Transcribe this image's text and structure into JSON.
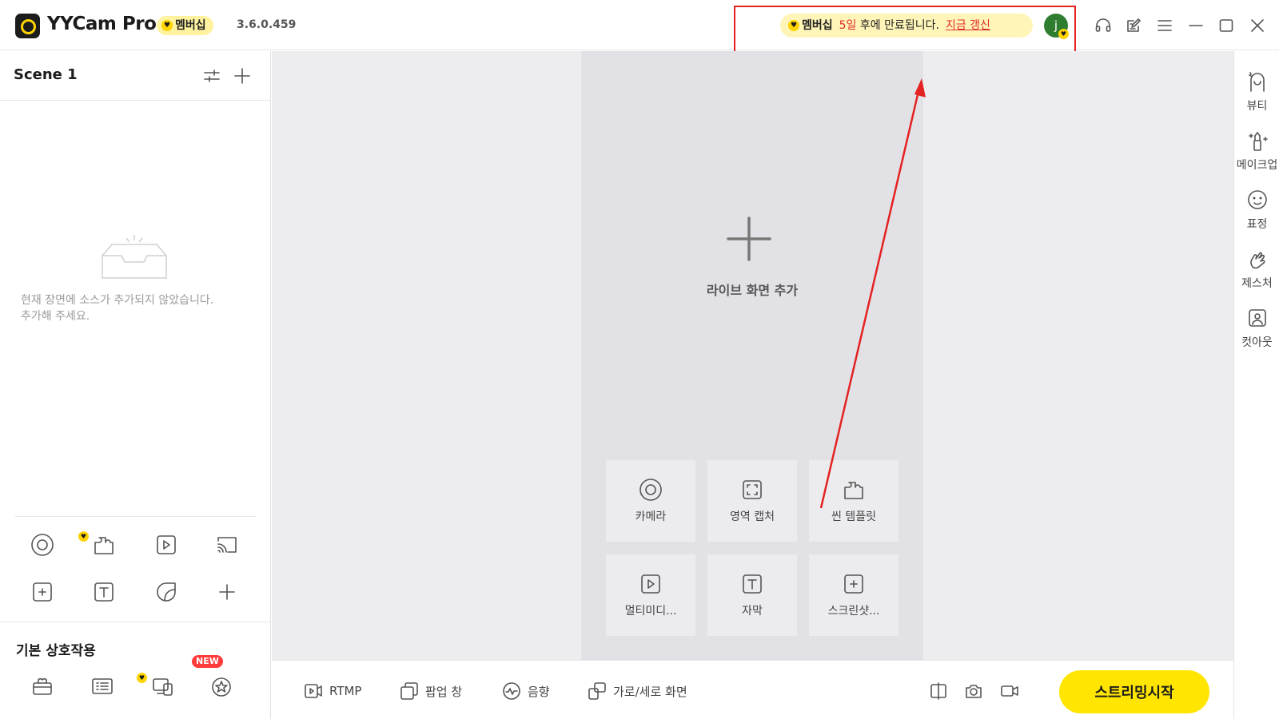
{
  "app": {
    "name": "YYCam Pro",
    "membership_label": "멤버십",
    "version": "3.6.0.459"
  },
  "notice": {
    "label": "멤버십",
    "days": "5일",
    "text": "후에 만료됩니다.",
    "renew": "지금 갱신"
  },
  "user": {
    "avatar_letter": "j"
  },
  "window_controls": [
    "headset-icon",
    "feedback-icon",
    "menu-icon",
    "minimize-icon",
    "maximize-icon",
    "close-icon"
  ],
  "scene": {
    "title": "Scene 1",
    "empty_line1": "현재 장면에 소스가 추가되지 않았습니다.",
    "empty_line2": "추가해 주세요."
  },
  "source_icons": [
    "camera-icon",
    "scene-template-icon",
    "multimedia-icon",
    "cast-icon",
    "screenshot-icon",
    "text-icon",
    "sticker-icon",
    "add-icon"
  ],
  "basic_interaction": {
    "title": "기본 상호작용",
    "badge_new": "NEW",
    "icons": [
      "gift-icon",
      "board-icon",
      "devices-icon",
      "badge-star-icon"
    ]
  },
  "stage": {
    "add_label": "라이브 화면 추가",
    "tiles": [
      {
        "label": "카메라",
        "icon": "camera-icon"
      },
      {
        "label": "영역 캡처",
        "icon": "region-capture-icon"
      },
      {
        "label": "씬 템플릿",
        "icon": "scene-template-icon"
      },
      {
        "label": "멀티미디...",
        "icon": "multimedia-icon"
      },
      {
        "label": "자막",
        "icon": "text-icon"
      },
      {
        "label": "스크린샷...",
        "icon": "screenshot-icon"
      }
    ]
  },
  "bottom": {
    "rtmp": "RTMP",
    "popup": "팝업 창",
    "audio": "음향",
    "orientation": "가로/세로 화면",
    "stream_button": "스트리밍시작"
  },
  "right_rail": [
    {
      "label": "뷰티",
      "icon": "beauty-icon"
    },
    {
      "label": "메이크업",
      "icon": "makeup-icon"
    },
    {
      "label": "표정",
      "icon": "expression-icon"
    },
    {
      "label": "제스처",
      "icon": "gesture-icon"
    },
    {
      "label": "컷아웃",
      "icon": "cutout-icon"
    }
  ],
  "colors": {
    "accent_yellow": "#ffe500",
    "badge_yellow": "#fff3a0",
    "alert_red": "#e02b2b",
    "avatar_green": "#2f7d2f"
  }
}
